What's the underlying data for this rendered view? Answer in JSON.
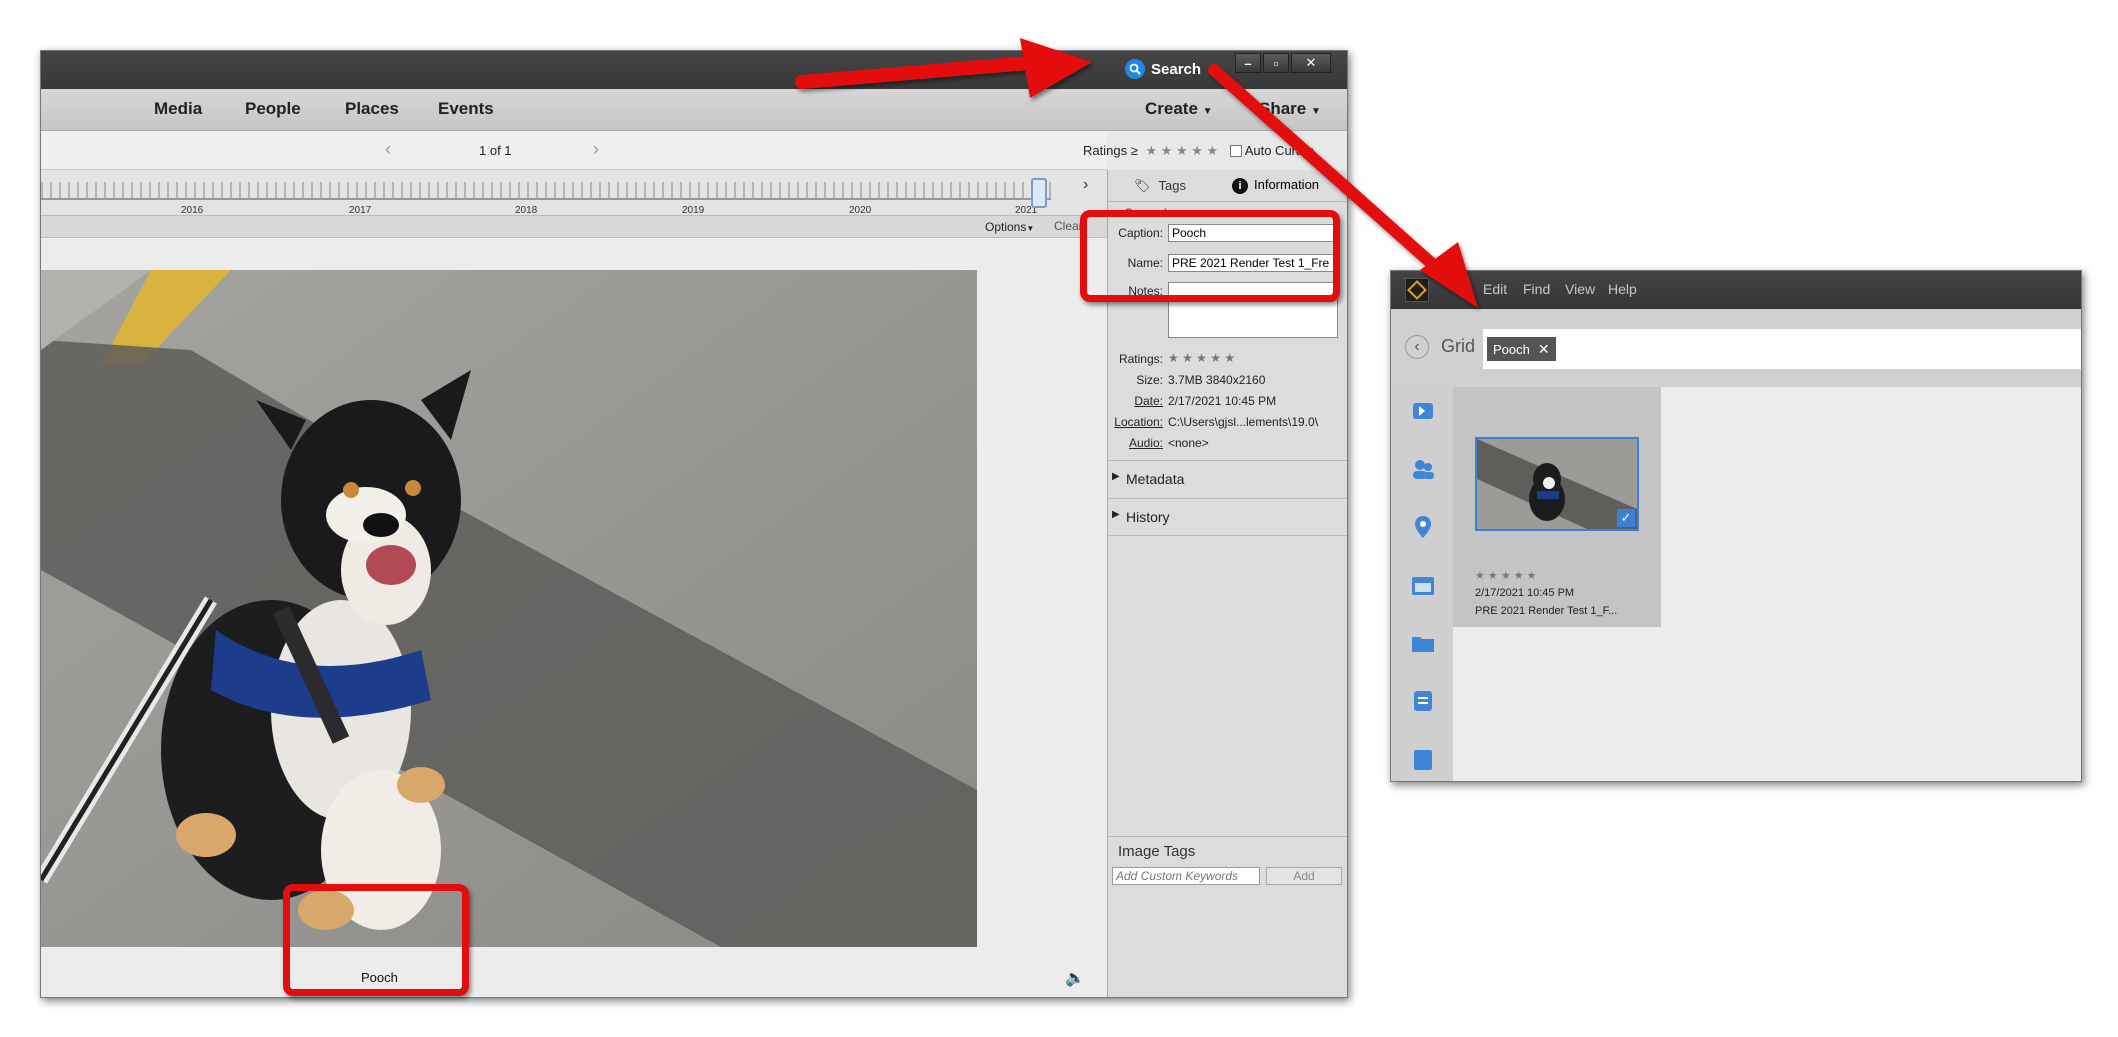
{
  "main_window": {
    "search_label": "Search",
    "window_controls": {
      "minimize": "–",
      "maximize": "▫",
      "close": "✕"
    },
    "nav": {
      "media": "Media",
      "people": "People",
      "places": "Places",
      "events": "Events",
      "create": "Create",
      "share": "Share"
    },
    "pager": "1 of 1",
    "ratings_label": "Ratings ≥",
    "ratings_stars": "★ ★ ★ ★ ★",
    "auto_curate": "Auto Curate",
    "timeline_years": [
      "2016",
      "2017",
      "2018",
      "2019",
      "2020",
      "2021"
    ],
    "options_label": "Options",
    "clear_label": "Clear",
    "photo_caption": "Pooch"
  },
  "right_panel": {
    "tabs": {
      "tags": "Tags",
      "information": "Information"
    },
    "general_heading": "General",
    "caption_label": "Caption:",
    "caption_value": "Pooch",
    "name_label": "Name:",
    "name_value": "PRE 2021 Render Test 1_Fre",
    "notes_label": "Notes:",
    "ratings_label": "Ratings:",
    "ratings_stars": "★ ★ ★ ★ ★",
    "size_label": "Size:",
    "size_value": "3.7MB  3840x2160",
    "date_label": "Date:",
    "date_value": "2/17/2021 10:45 PM",
    "location_label": "Location:",
    "location_value": "C:\\Users\\gjsl...lements\\19.0\\",
    "audio_label": "Audio:",
    "audio_value": "<none>",
    "metadata_label": "Metadata",
    "history_label": "History",
    "image_tags_label": "Image Tags",
    "keywords_placeholder": "Add Custom Keywords",
    "add_button": "Add"
  },
  "search_window": {
    "menu": {
      "edit": "Edit",
      "find": "Find",
      "view": "View",
      "help": "Help"
    },
    "grid_label": "Grid",
    "search_tag": "Pooch",
    "thumb_stars": "★ ★ ★ ★ ★",
    "thumb_date": "2/17/2021 10:45 PM",
    "thumb_name": "PRE 2021 Render Test 1_F..."
  },
  "colors": {
    "annotation_red": "#e30d0d",
    "search_blue": "#1f88e5",
    "selection_blue": "#3d7fd6"
  }
}
